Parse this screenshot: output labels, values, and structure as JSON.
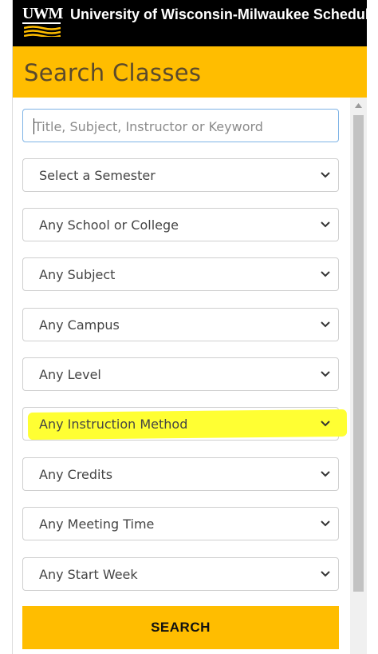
{
  "header": {
    "logo_text": "UWM",
    "app_title": "University of Wisconsin-Milwaukee Schedule of Classes"
  },
  "page": {
    "title": "Search Classes"
  },
  "search": {
    "placeholder": "Title, Subject, Instructor or Keyword",
    "value": ""
  },
  "filters": [
    {
      "label": "Select a Semester"
    },
    {
      "label": "Any School or College"
    },
    {
      "label": "Any Subject"
    },
    {
      "label": "Any Campus"
    },
    {
      "label": "Any Level"
    },
    {
      "label": "Any Instruction Method",
      "highlighted": true
    },
    {
      "label": "Any Credits"
    },
    {
      "label": "Any Meeting Time"
    },
    {
      "label": "Any Start Week"
    }
  ],
  "actions": {
    "search_label": "SEARCH"
  },
  "colors": {
    "brand_gold": "#ffbd00",
    "top_bar": "#000000",
    "highlight": "#ffff33",
    "input_focus_border": "#7fb4e6"
  },
  "icons": {
    "dropdown": "chevron-down-icon",
    "scroll_up": "scroll-up-arrow-icon"
  }
}
